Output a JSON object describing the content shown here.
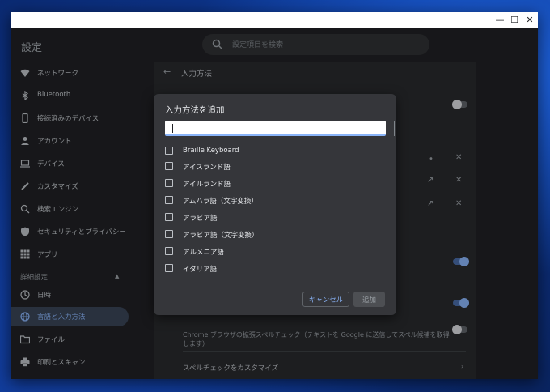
{
  "window": {
    "min_glyph": "—",
    "max_glyph": "☐",
    "close_glyph": "✕"
  },
  "header": {
    "title": "設定",
    "search_placeholder": "設定項目を検索"
  },
  "sidebar": {
    "items": [
      {
        "label": "ネットワーク",
        "icon": "wifi-icon"
      },
      {
        "label": "Bluetooth",
        "icon": "bluetooth-icon"
      },
      {
        "label": "接続済みのデバイス",
        "icon": "phone-icon"
      },
      {
        "label": "アカウント",
        "icon": "person-icon"
      },
      {
        "label": "デバイス",
        "icon": "laptop-icon"
      },
      {
        "label": "カスタマイズ",
        "icon": "brush-icon"
      },
      {
        "label": "検索エンジン",
        "icon": "search-icon"
      },
      {
        "label": "セキュリティとプライバシー",
        "icon": "shield-icon"
      },
      {
        "label": "アプリ",
        "icon": "apps-grid-icon"
      }
    ],
    "advanced_label": "詳細設定",
    "advanced_items": [
      {
        "label": "日時",
        "icon": "clock-icon"
      },
      {
        "label": "言語と入力方法",
        "icon": "globe-icon",
        "active": true
      },
      {
        "label": "ファイル",
        "icon": "folder-icon"
      },
      {
        "label": "印刷とスキャン",
        "icon": "printer-icon"
      }
    ]
  },
  "main": {
    "back_glyph": "←",
    "title": "入力方法",
    "spell_text": "Chrome ブラウザの拡張スペルチェック（テキストを Google に送信してスペル候補を取得します）",
    "spell_customize": "スペルチェックをカスタマイズ",
    "chevron": "›"
  },
  "dialog": {
    "title": "入力方法を追加",
    "search_value": "",
    "options": [
      "Braille Keyboard",
      "アイスランド語",
      "アイルランド語",
      "アムハラ語（文字変換）",
      "アラビア語",
      "アラビア語（文字変換）",
      "アルメニア語",
      "イタリア語"
    ],
    "cancel_label": "キャンセル",
    "add_label": "追加"
  },
  "colors": {
    "accent": "#8ab4f8",
    "active_nav_bg": "#394457",
    "surface": "#292a2d",
    "dialog_bg": "#35363a"
  }
}
